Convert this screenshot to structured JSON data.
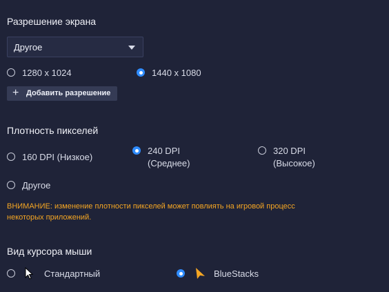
{
  "resolution": {
    "title": "Разрешение экрана",
    "dropdown_value": "Другое",
    "options": [
      "1280 x 1024",
      "1440 x 1080"
    ],
    "selected": "1440 x 1080",
    "add_button_label": "Добавить разрешение"
  },
  "density": {
    "title": "Плотность пикселей",
    "options": [
      {
        "line1": "160 DPI (Низкое)",
        "line2": ""
      },
      {
        "line1": "240 DPI",
        "line2": "(Среднее)"
      },
      {
        "line1": "320 DPI",
        "line2": "(Высокое)"
      },
      {
        "line1": "Другое",
        "line2": ""
      }
    ],
    "selected": "240 DPI",
    "warning_line1": "ВНИМАНИЕ: изменение плотности пикселей может повлиять на игровой процесс",
    "warning_line2": "некоторых приложений."
  },
  "cursor": {
    "title": "Вид курсора мыши",
    "options": [
      "Стандартный",
      "BlueStacks"
    ],
    "selected": "BlueStacks",
    "icons": [
      "standard-cursor-icon",
      "bluestacks-cursor-icon"
    ]
  },
  "colors": {
    "background": "#1f2338",
    "accent": "#2f8cff",
    "warning": "#f5a623",
    "cursor_bluestacks": "#f5a623"
  }
}
